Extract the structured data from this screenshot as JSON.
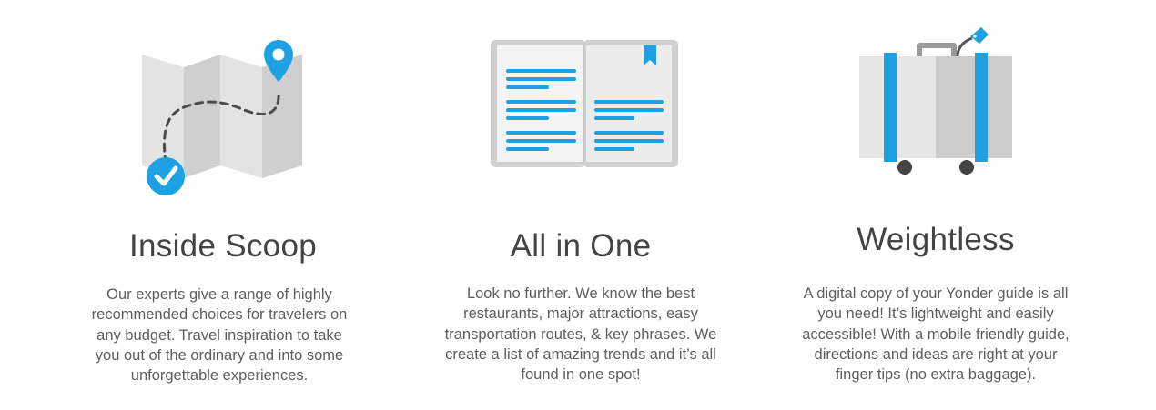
{
  "features": [
    {
      "title": "Inside Scoop",
      "icon": "folded-map-route-icon",
      "description": "Our experts give a range of highly recommended choices for travelers on any budget. Travel inspiration to take you out of the ordinary and into some unforgettable experiences."
    },
    {
      "title": "All in One",
      "icon": "open-guidebook-icon",
      "description": "Look no further. We know the best restaurants, major attractions, easy transportation routes, & key phrases. We create a list of amazing trends and it’s all found in one spot!"
    },
    {
      "title": "Weightless",
      "icon": "rolling-suitcase-icon",
      "description": "A digital copy of your Yonder guide is all you need! It’s  lightweight and easily accessible! With a mobile friendly guide, directions and ideas are right at your finger tips (no extra baggage)."
    }
  ],
  "colors": {
    "accent": "#1da1e2",
    "light_gray": "#e6e6e6",
    "mid_gray": "#cccccc",
    "dark_gray": "#444444",
    "text": "#5e5e5e"
  }
}
